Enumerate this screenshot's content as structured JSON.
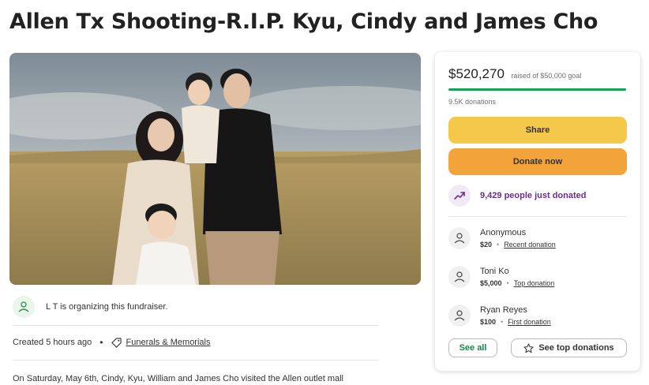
{
  "page": {
    "title": "Allen Tx Shooting-R.I.P. Kyu, Cindy and James Cho"
  },
  "organizer": {
    "text": "L T is organizing this fundraiser."
  },
  "meta": {
    "created": "Created 5 hours ago",
    "separator": "•",
    "category": "Funerals & Memorials"
  },
  "story": {
    "first_line": "On Saturday, May 6th, Cindy, Kyu, William and James Cho visited the Allen outlet mall"
  },
  "donation_card": {
    "raised": "$520,270",
    "goal_text": "raised of $50,000 goal",
    "progress_fraction": 1.0,
    "donation_count": "9.5K donations",
    "share_label": "Share",
    "donate_label": "Donate now",
    "trend_text": "9,429 people just donated",
    "donors": [
      {
        "name": "Anonymous",
        "amount": "$20",
        "tag": "Recent donation"
      },
      {
        "name": "Toni Ko",
        "amount": "$5,000",
        "tag": "Top donation"
      },
      {
        "name": "Ryan Reyes",
        "amount": "$100",
        "tag": "First donation"
      }
    ],
    "see_all_label": "See all",
    "see_top_label": "See top donations"
  },
  "colors": {
    "progress": "#12a454",
    "share": "#f4c84a",
    "donate": "#f2a33a",
    "trend": "#6a2c8e",
    "see_all": "#0e8b45"
  },
  "icons": {
    "organizer": "heart-hand-icon",
    "category": "tag-icon",
    "trend": "trend-up-icon",
    "donor": "heart-hand-icon",
    "top": "star-icon"
  }
}
